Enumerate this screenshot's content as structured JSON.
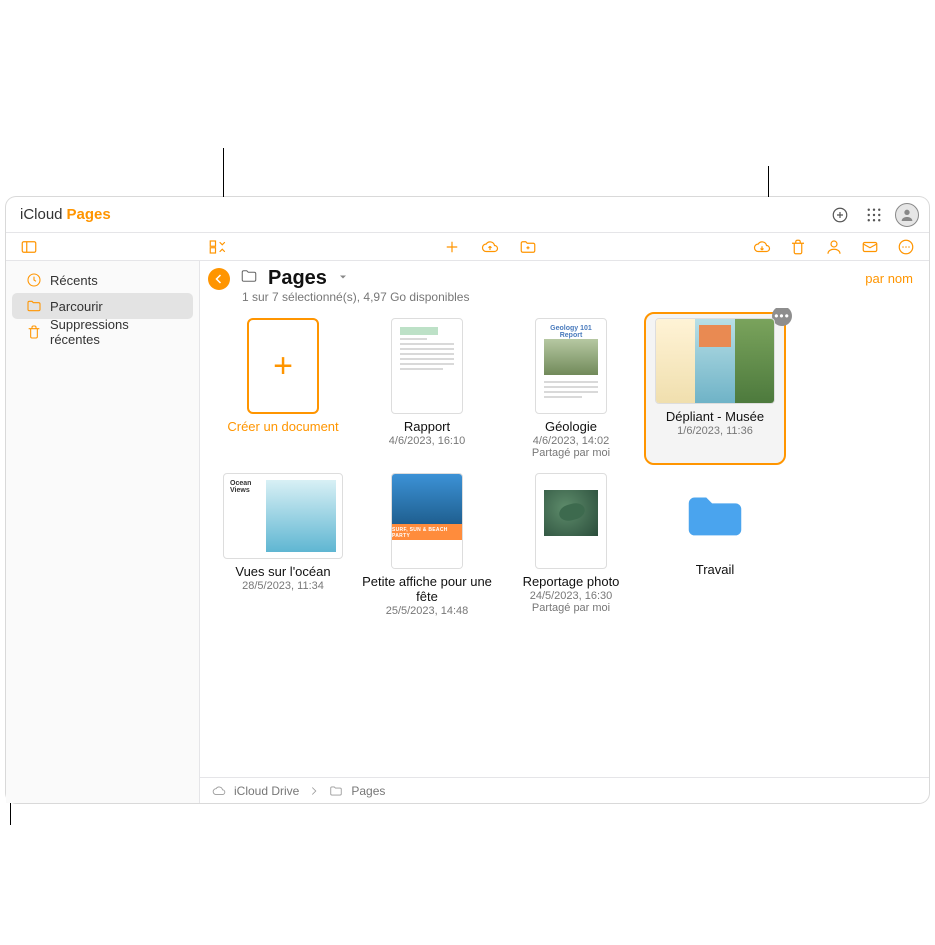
{
  "brand": {
    "icloud": "iCloud",
    "app": "Pages"
  },
  "sidebar": {
    "items": [
      {
        "id": "recents",
        "label": "Récents"
      },
      {
        "id": "browse",
        "label": "Parcourir"
      },
      {
        "id": "deleted",
        "label": "Suppressions récentes"
      }
    ],
    "active_id": "browse"
  },
  "header": {
    "location_title": "Pages",
    "status": "1 sur 7 sélectionné(s), 4,97 Go disponibles",
    "sort_label": "par nom"
  },
  "create_tile": {
    "label": "Créer un document"
  },
  "documents": [
    {
      "id": "rapport",
      "title": "Rapport",
      "meta": "4/6/2023, 16:10",
      "shared": "",
      "shape": "page",
      "style": "report"
    },
    {
      "id": "geologie",
      "title": "Géologie",
      "meta": "4/6/2023, 14:02",
      "shared": "Partagé par moi",
      "shape": "page",
      "style": "geo"
    },
    {
      "id": "depliant",
      "title": "Dépliant - Musée",
      "meta": "1/6/2023, 11:36",
      "shared": "",
      "shape": "wide",
      "style": "tri",
      "selected": true
    },
    {
      "id": "ocean",
      "title": "Vues sur l'océan",
      "meta": "28/5/2023, 11:34",
      "shared": "",
      "shape": "wide",
      "style": "ocean"
    },
    {
      "id": "affiche",
      "title": "Petite affiche pour une fête",
      "meta": "25/5/2023, 14:48",
      "shared": "",
      "shape": "page",
      "style": "party"
    },
    {
      "id": "photo",
      "title": "Reportage photo",
      "meta": "24/5/2023, 16:30",
      "shared": "Partagé par moi",
      "shape": "page",
      "style": "turtle"
    },
    {
      "id": "travail",
      "title": "Travail",
      "meta": "",
      "shared": "",
      "shape": "folder",
      "style": "folder"
    }
  ],
  "breadcrumb": {
    "root": "iCloud Drive",
    "leaf": "Pages"
  },
  "icons": {
    "sidebar_toggle": "sidebar-icon",
    "view_mode": "grid-icon",
    "add": "plus-icon",
    "upload": "cloud-upload-icon",
    "new_folder": "new-folder-icon",
    "download": "cloud-download-icon",
    "trash": "trash-icon",
    "collab": "people-icon",
    "mail": "mail-icon",
    "more": "more-icon",
    "create": "plus-circle-icon",
    "apps": "apps-grid-icon",
    "account": "account-icon"
  }
}
